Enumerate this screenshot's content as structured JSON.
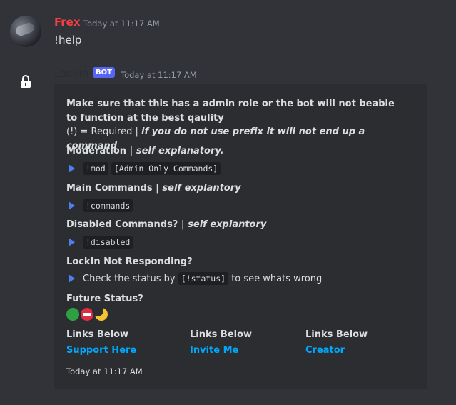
{
  "message1": {
    "author": "Frex",
    "timestamp": "Today at 11:17 AM",
    "content": "!help"
  },
  "message2": {
    "author": "LockIn",
    "bot_badge": "BOT",
    "timestamp": "Today at 11:17 AM",
    "embed": {
      "desc_line1": "Make sure that this has a admin role or the bot will not beable to function at the best qaulity",
      "desc_line2_plain": "(!) = Required | ",
      "desc_line2_italic": "if you do not use prefix it will not end up a command",
      "fields": [
        {
          "name_plain": "Moderation | ",
          "name_italic": "self explanatory.",
          "value_code": "!mod",
          "value_code2": "[Admin Only Commands]"
        },
        {
          "name_plain": "Main Commands | ",
          "name_italic": "self explantory",
          "value_code": "!commands"
        },
        {
          "name_plain": "Disabled Commands? | ",
          "name_italic": "self explantory",
          "value_code": "!disabled"
        },
        {
          "name_plain": "LockIn Not Responding?",
          "value_pre": "Check the status by ",
          "value_code": "[!status]",
          "value_post": " to see whats wrong"
        },
        {
          "name_plain": "Future Status?"
        }
      ],
      "link_columns": [
        {
          "name": "Links Below",
          "link": "Support Here"
        },
        {
          "name": "Links Below",
          "link": "Invite Me"
        },
        {
          "name": "Links Below",
          "link": "Creator"
        }
      ],
      "footer": "Today at 11:17 AM"
    }
  },
  "colors": {
    "background": "#313338",
    "embed_bg": "#2b2d31",
    "author1": "#f23f42",
    "link": "#00a8fc",
    "bot_badge": "#5865f2"
  },
  "icons": [
    "avatar",
    "lock-icon",
    "triangle-bullet-icon",
    "green-circle-emoji",
    "no-entry-emoji",
    "crescent-moon-emoji"
  ]
}
